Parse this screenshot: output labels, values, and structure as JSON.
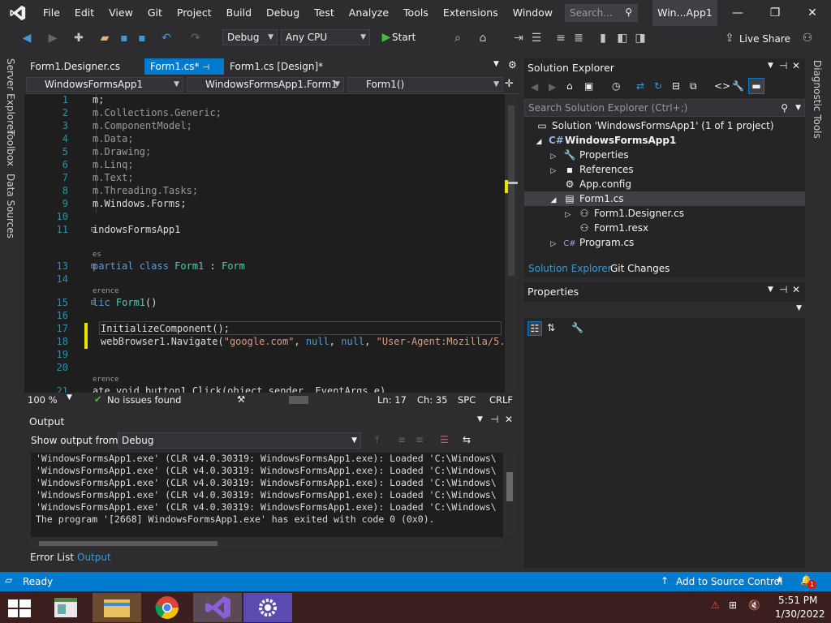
{
  "titlebar": {
    "menus": [
      "File",
      "Edit",
      "View",
      "Git",
      "Project",
      "Build",
      "Debug",
      "Test",
      "Analyze",
      "Tools",
      "Extensions",
      "Window",
      "Help"
    ],
    "search_placeholder": "Search...",
    "window_title": "Win...App1",
    "minimize": "—",
    "maximize": "❐",
    "close": "✕"
  },
  "toolbar": {
    "config": "Debug",
    "platform": "Any CPU",
    "start_label": "Start",
    "live_share": "Live Share"
  },
  "left_strip": [
    "Server Explorer",
    "Toolbox",
    "Data Sources"
  ],
  "right_strip": "Diagnostic Tools",
  "doc_tabs": [
    "Form1.Designer.cs",
    "Form1.cs*",
    "Form1.cs [Design]*"
  ],
  "nav": {
    "project": "WindowsFormsApp1",
    "class": "WindowsFormsApp1.Form1",
    "member": "Form1()"
  },
  "editor": {
    "line_numbers": [
      "1",
      "2",
      "3",
      "4",
      "5",
      "6",
      "7",
      "8",
      "9",
      "10",
      "11",
      "",
      "13",
      "14",
      "",
      "15",
      "16",
      "17",
      "18",
      "19",
      "20",
      "",
      "21"
    ],
    "lines": {
      "l1": "m;",
      "l2": "m.Collections.Generic;",
      "l3": "m.ComponentModel;",
      "l4": "m.Data;",
      "l5": "m.Drawing;",
      "l6": "m.Linq;",
      "l7": "m.Text;",
      "l8": "m.Threading.Tasks;",
      "l9": "m.Windows.Forms;",
      "l11": "indowsFormsApp1",
      "ref1": "es",
      "l13a": "partial class ",
      "l13b": "Form1",
      "l13c": " : ",
      "l13d": "Form",
      "ref2": "erence",
      "l15a": "lic ",
      "l15b": "Form1",
      "l15c": "()",
      "l17": "InitializeComponent();",
      "l18a": "webBrowser1.Navigate(",
      "l18b": "\"google.com\"",
      "l18c": ", ",
      "l18d": "null",
      "l18e": ", ",
      "l18f": "null",
      "l18g": ", ",
      "l18h": "\"User-Agent:Mozilla/5.0",
      "ref3": "erence",
      "l21": "ate void button1_Click(object sender, EventArgs e)"
    }
  },
  "editor_status": {
    "zoom": "100 %",
    "issues": "No issues found",
    "ln": "Ln: 17",
    "ch": "Ch: 35",
    "spc": "SPC",
    "crlf": "CRLF"
  },
  "output": {
    "title": "Output",
    "show_from_label": "Show output from:",
    "show_from_value": "Debug",
    "lines": [
      "'WindowsFormsApp1.exe' (CLR v4.0.30319: WindowsFormsApp1.exe): Loaded 'C:\\Windows\\",
      "'WindowsFormsApp1.exe' (CLR v4.0.30319: WindowsFormsApp1.exe): Loaded 'C:\\Windows\\",
      "'WindowsFormsApp1.exe' (CLR v4.0.30319: WindowsFormsApp1.exe): Loaded 'C:\\Windows\\",
      "'WindowsFormsApp1.exe' (CLR v4.0.30319: WindowsFormsApp1.exe): Loaded 'C:\\Windows\\",
      "'WindowsFormsApp1.exe' (CLR v4.0.30319: WindowsFormsApp1.exe): Loaded 'C:\\Windows\\",
      "The program '[2668] WindowsFormsApp1.exe' has exited with code 0 (0x0)."
    ],
    "tabs": [
      "Error List",
      "Output"
    ]
  },
  "solution_explorer": {
    "title": "Solution Explorer",
    "search_placeholder": "Search Solution Explorer (Ctrl+;)",
    "tree": [
      "Solution 'WindowsFormsApp1' (1 of 1 project)",
      "WindowsFormsApp1",
      "Properties",
      "References",
      "App.config",
      "Form1.cs",
      "Form1.Designer.cs",
      "Form1.resx",
      "Program.cs"
    ],
    "tabs": [
      "Solution Explorer",
      "Git Changes"
    ]
  },
  "properties": {
    "title": "Properties"
  },
  "statusbar": {
    "ready": "Ready",
    "source_control": "Add to Source Control",
    "badge": "1"
  },
  "taskbar": {
    "time": "5:51 PM",
    "date": "1/30/2022"
  },
  "colors": {
    "accent": "#007acc",
    "bg": "#2d2d30",
    "editor_bg": "#1e1e1e"
  }
}
